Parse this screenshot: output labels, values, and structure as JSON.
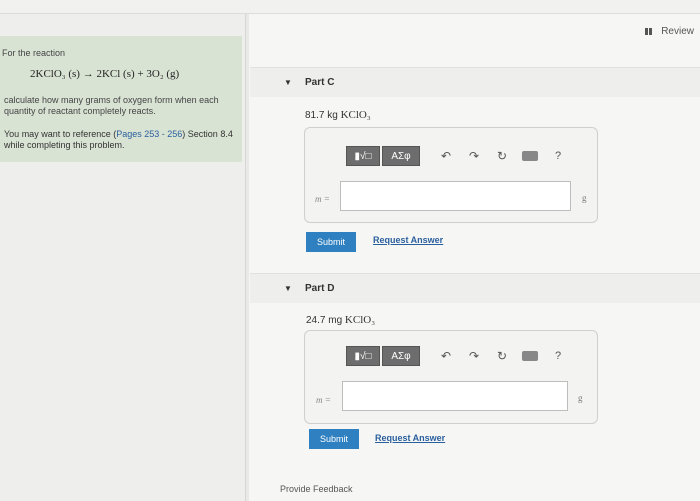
{
  "header": {
    "review_label": "Review"
  },
  "left": {
    "intro": "For the reaction",
    "equation": "2KClO₃ (s) → 2KCl (s) + 3O₂ (g)",
    "instruction": "calculate how many grams of oxygen form when each quantity of reactant completely reacts.",
    "ref_prefix": "You may want to reference (",
    "ref_pages": "Pages 253 - 256",
    "ref_suffix": ") Section 8.4 while completing this problem."
  },
  "parts": [
    {
      "title": "Part C",
      "quantity_value": "81.7 kg",
      "quantity_chem": "KClO₃",
      "var": "m =",
      "unit": "g",
      "submit": "Submit",
      "request": "Request Answer",
      "toolbar": {
        "templates": "▮√□",
        "greek": "ΑΣφ",
        "help": "?"
      }
    },
    {
      "title": "Part D",
      "quantity_value": "24.7 mg",
      "quantity_chem": "KClO₃",
      "var": "m =",
      "unit": "g",
      "submit": "Submit",
      "request": "Request Answer",
      "toolbar": {
        "templates": "▮√□",
        "greek": "ΑΣφ",
        "help": "?"
      }
    }
  ],
  "footer": {
    "feedback": "Provide Feedback"
  },
  "icons": [
    "caret-down-icon",
    "undo-icon",
    "redo-icon",
    "reset-icon",
    "keyboard-icon",
    "help-icon"
  ]
}
